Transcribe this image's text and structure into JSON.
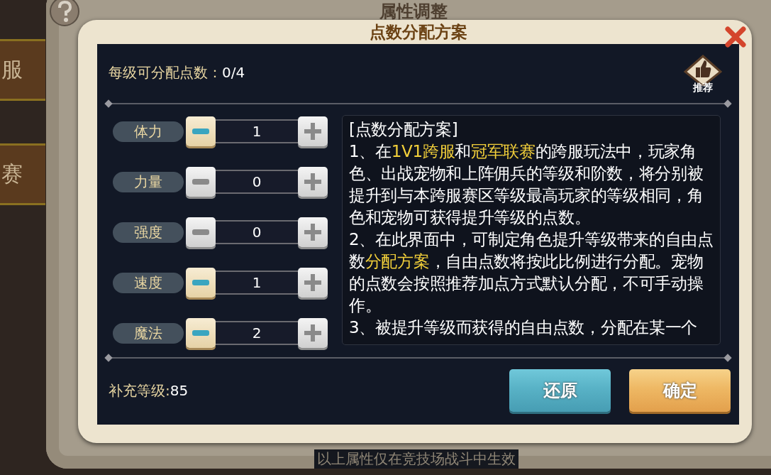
{
  "background_window": {
    "title": "属性调整",
    "side_tabs": [
      "服",
      "赛"
    ],
    "footer": "以上属性仅在竞技场战斗中生效"
  },
  "dialog": {
    "title": "点数分配方案",
    "points_per_level": {
      "label": "每级可分配点数：",
      "value": "0/4"
    },
    "recommend": {
      "label": "推荐"
    },
    "stats": [
      {
        "name": "体力",
        "value": "1",
        "minus_enabled": true
      },
      {
        "name": "力量",
        "value": "0",
        "minus_enabled": false
      },
      {
        "name": "强度",
        "value": "0",
        "minus_enabled": false
      },
      {
        "name": "速度",
        "value": "1",
        "minus_enabled": true
      },
      {
        "name": "魔法",
        "value": "2",
        "minus_enabled": true
      }
    ],
    "description": [
      [
        {
          "text": "[点数分配方案]",
          "highlight": false
        }
      ],
      [
        {
          "text": "1、在",
          "highlight": false
        },
        {
          "text": "1V1跨服",
          "highlight": true
        },
        {
          "text": "和",
          "highlight": false
        },
        {
          "text": "冠军联赛",
          "highlight": true
        },
        {
          "text": "的跨服玩法中，玩家角色、出战宠物和上阵佣兵的等级和阶数，将分别被提升到与本跨服赛区等级最高玩家的等级相同，角色和宠物可获得提升等级的点数。",
          "highlight": false
        }
      ],
      [
        {
          "text": "2、在此界面中，可制定角色提升等级带来的自由点数",
          "highlight": false
        },
        {
          "text": "分配方案",
          "highlight": true
        },
        {
          "text": "，自由点数将按此比例进行分配。宠物的点数会按照推荐加点方式默认分配，不可手动操作。",
          "highlight": false
        }
      ],
      [
        {
          "text": "3、被提升等级而获得的自由点数，分配在某一个",
          "highlight": false
        }
      ]
    ],
    "extra_level": {
      "label": "补充等级:",
      "value": "85"
    },
    "buttons": [
      {
        "label": "还原",
        "kind": "secondary"
      },
      {
        "label": "确定",
        "kind": "primary"
      }
    ]
  }
}
